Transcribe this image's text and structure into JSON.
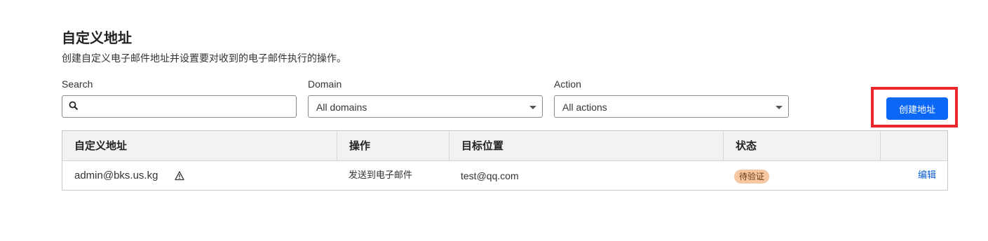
{
  "page": {
    "title": "自定义地址",
    "subtitle": "创建自定义电子邮件地址并设置要对收到的电子邮件执行的操作。"
  },
  "filters": {
    "search_label": "Search",
    "search_value": "",
    "domain_label": "Domain",
    "domain_selected": "All domains",
    "action_label": "Action",
    "action_selected": "All actions"
  },
  "create_button_label": "创建地址",
  "table": {
    "headers": [
      "自定义地址",
      "操作",
      "目标位置",
      "状态"
    ],
    "rows": [
      {
        "address": "admin@bks.us.kg",
        "action": "发送到电子邮件",
        "destination": "test@qq.com",
        "status": "待验证",
        "edit_label": "编辑"
      }
    ]
  },
  "colors": {
    "primary_button": "#0b67f5",
    "highlight_border": "#e8262b",
    "status_badge_bg": "#f6c8a2",
    "link": "#0b5cd5"
  },
  "icons": {
    "search": "search-icon",
    "warning": "warning-icon",
    "dropdown": "chevron-down-icon"
  }
}
